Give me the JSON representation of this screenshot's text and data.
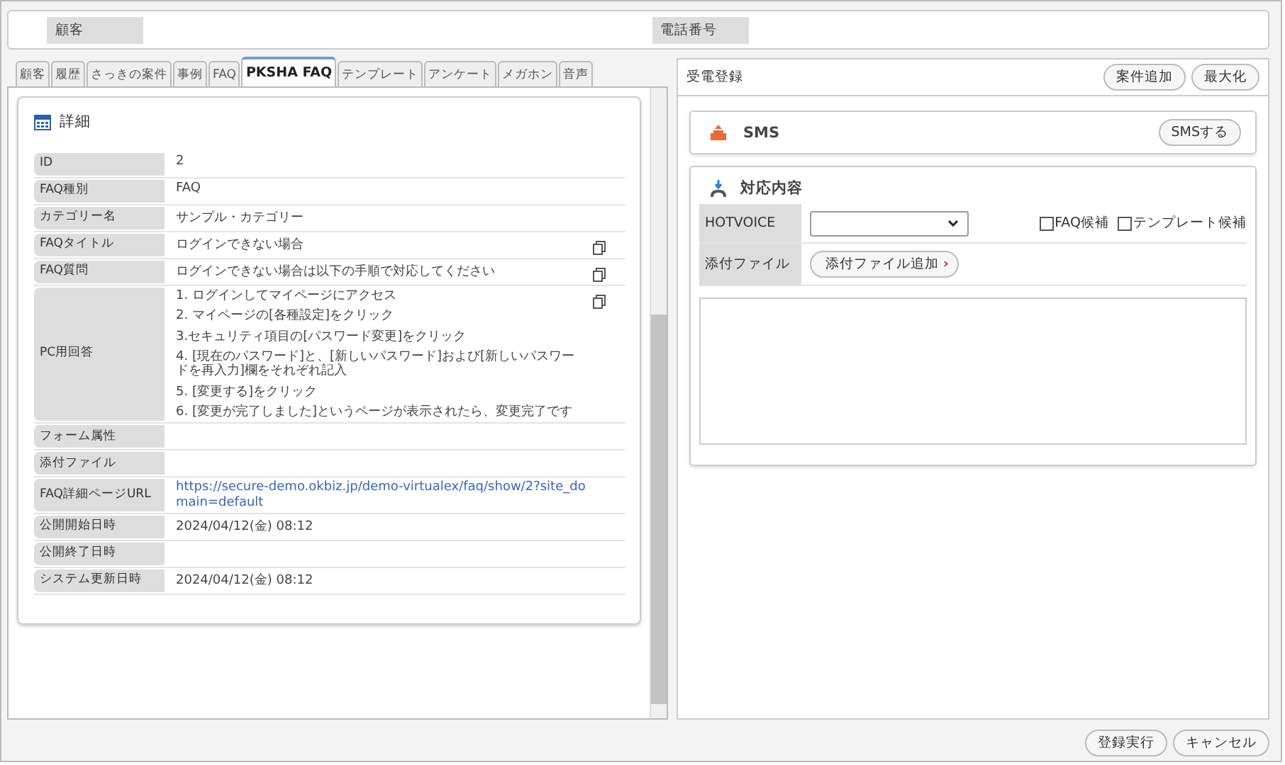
{
  "customer_bar": {
    "fields": [
      {
        "label": "顧客"
      },
      {
        "label": "電話番号"
      }
    ]
  },
  "tabs": [
    {
      "label": "顧客",
      "selected": false
    },
    {
      "label": "履歴",
      "selected": false
    },
    {
      "label": "さっきの案件",
      "selected": false
    },
    {
      "label": "事例",
      "selected": false
    },
    {
      "label": "FAQ",
      "selected": false
    },
    {
      "label": "PKSHA FAQ",
      "selected": true
    },
    {
      "label": "テンプレート",
      "selected": false
    },
    {
      "label": "アンケート",
      "selected": false
    },
    {
      "label": "メガホン",
      "selected": false
    },
    {
      "label": "音声",
      "selected": false
    }
  ],
  "detail": {
    "title": "詳細",
    "rows": [
      {
        "label": "ID",
        "kind": "text",
        "value": "2",
        "copy": false
      },
      {
        "label": "FAQ種別",
        "kind": "text",
        "value": "FAQ",
        "copy": false
      },
      {
        "label": "カテゴリー名",
        "kind": "text",
        "value": "サンプル・カテゴリー",
        "copy": false
      },
      {
        "label": "FAQタイトル",
        "kind": "text",
        "value": "ログインできない場合",
        "copy": true
      },
      {
        "label": "FAQ質問",
        "kind": "text",
        "value": "ログインできない場合は以下の手順で対応してください",
        "copy": true
      },
      {
        "label": "PC用回答",
        "kind": "lines",
        "lines": [
          "1. ログインしてマイページにアクセス",
          "2. マイページの[各種設定]をクリック",
          "3.セキュリティ項目の[パスワード変更]をクリック",
          "4. [現在のパスワード]と、[新しいパスワード]および[新しいパスワードを再入力]欄をそれぞれ記入",
          "5. [変更する]をクリック",
          "6. [変更が完了しました]というページが表示されたら、変更完了です"
        ],
        "copy": true
      },
      {
        "label": "フォーム属性",
        "kind": "text",
        "copy": false
      },
      {
        "label": "添付ファイル",
        "kind": "text",
        "copy": false
      },
      {
        "label": "FAQ詳細ページURL",
        "kind": "link",
        "value": "https://secure-demo.okbiz.jp/demo-virtualex/faq/show/2?site_domain=default",
        "copy": false
      },
      {
        "label": "公開開始日時",
        "kind": "text",
        "value": "2024/04/12(金) 08:12",
        "copy": false
      },
      {
        "label": "公開終了日時",
        "kind": "text",
        "copy": false
      },
      {
        "label": "システム更新日時",
        "kind": "text",
        "value": "2024/04/12(金) 08:12",
        "copy": false
      }
    ]
  },
  "right_panel": {
    "title": "受電登録",
    "buttons": [
      "案件追加",
      "最大化"
    ],
    "sms": {
      "title": "SMS",
      "button": "SMSする"
    },
    "response": {
      "title": "対応内容",
      "hotvoice_label": "HOTVOICE",
      "checkboxes": [
        {
          "label": "FAQ候補",
          "checked": false
        },
        {
          "label": "テンプレート候補",
          "checked": false
        }
      ],
      "attachment_label": "添付ファイル",
      "attachment_button": "添付ファイル追加",
      "attachment_arrow": "›"
    }
  },
  "footer_buttons": [
    "登録実行",
    "キャンセル"
  ]
}
